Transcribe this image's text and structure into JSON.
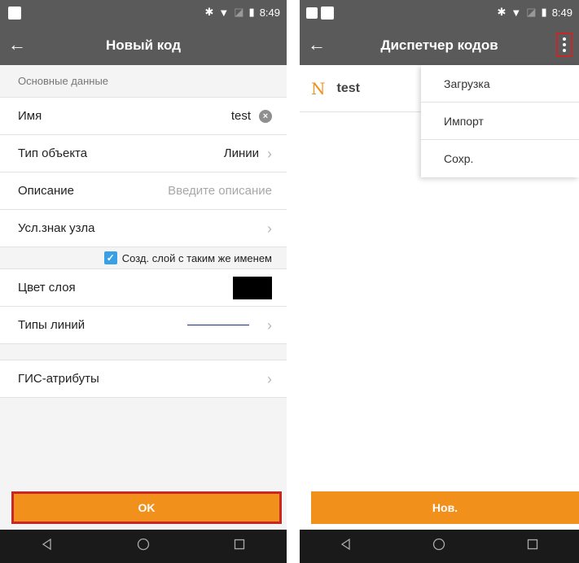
{
  "left_screen": {
    "status_bar": {
      "time": "8:49"
    },
    "app_bar": {
      "title": "Новый код"
    },
    "section_header": "Основные данные",
    "fields": {
      "name_label": "Имя",
      "name_value": "test",
      "object_type_label": "Тип объекта",
      "object_type_value": "Линии",
      "description_label": "Описание",
      "description_placeholder": "Введите описание",
      "node_symbol_label": "Усл.знак узла",
      "create_layer_checkbox": "Созд. слой с таким же именем",
      "layer_color_label": "Цвет слоя",
      "line_types_label": "Типы линий",
      "gis_attributes_label": "ГИС-атрибуты"
    },
    "ok_button": "OK"
  },
  "right_screen": {
    "status_bar": {
      "time": "8:49"
    },
    "app_bar": {
      "title": "Диспетчер кодов"
    },
    "codes": [
      {
        "name": "test",
        "icon": "polyline-icon"
      }
    ],
    "menu": [
      "Загрузка",
      "Импорт",
      "Сохр."
    ],
    "new_button": "Нов."
  },
  "colors": {
    "bar": "#5a5a5a",
    "accent": "#f2901c",
    "highlight": "#c62828",
    "checkbox": "#3aa0e6",
    "layer_color": "#000000"
  }
}
